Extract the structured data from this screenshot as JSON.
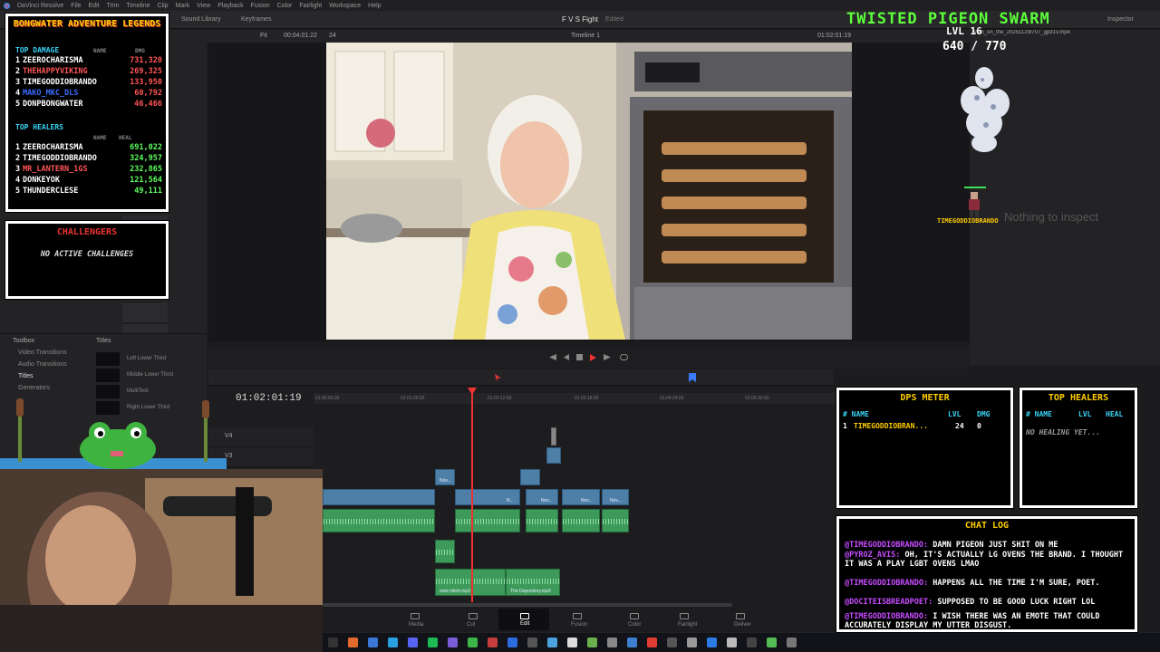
{
  "app": {
    "menu": [
      "DaVinci Resolve",
      "File",
      "Edit",
      "Trim",
      "Timeline",
      "Clip",
      "Mark",
      "View",
      "Playback",
      "Fusion",
      "Color",
      "Fairlight",
      "Workspace",
      "Help"
    ],
    "toolbar": {
      "sound_library": "Sound Library",
      "keyframes": "Keyframes",
      "inspector": "Inspector"
    },
    "project": {
      "name": "F V S Fight",
      "status": "Edited"
    }
  },
  "viewer": {
    "zoom": "Fit",
    "source_tc": "00:04:01:22",
    "fps": "24",
    "timeline_name": "Timeline 1",
    "record_tc": "01:02:01:19",
    "clip_name": "Man_on_the_20251129l707_gpd1v.mp4"
  },
  "inspector": {
    "empty_text": "Nothing to inspect"
  },
  "effects": {
    "toolbox_label": "Toolbox",
    "titles_header": "Titles",
    "items": [
      "Video Transitions",
      "Audio Transitions",
      "Titles",
      "Generators"
    ],
    "titles": [
      "Left Lower Third",
      "Middle Lower Third",
      "MultiText",
      "Right Lower Third"
    ]
  },
  "timeline": {
    "timecode": "01:02:01:19",
    "ruler": [
      "01:00:00:00",
      "01:01:36:00",
      "01:02:12:00",
      "01:03:18:00",
      "01:04:24:00",
      "01:05:30:00"
    ],
    "tracks": [
      "V4",
      "V3"
    ],
    "clip_labels": {
      "nov": "Nov...",
      "audio1": "oven bitch.mp3",
      "audio2": "The Depository.mp3",
      "n": "N..."
    }
  },
  "pages": [
    "Media",
    "Cut",
    "Edit",
    "Fusion",
    "Color",
    "Fairlight",
    "Deliver"
  ],
  "overlay": {
    "legends_title": "BONGWATER ADVENTURE LEGENDS",
    "top_damage_label": "TOP DAMAGE",
    "top_healers_label": "TOP HEALERS",
    "name_hdr": "NAME",
    "dmg_hdr": "DMG",
    "heal_hdr": "HEAL",
    "top_damage": [
      {
        "rank": "1",
        "name": "ZEEROCHARISMA",
        "value": "731,320",
        "color": "#ffffff",
        "vcolor": "#ff5555"
      },
      {
        "rank": "2",
        "name": "THEHAPPYVIKING",
        "value": "269,325",
        "color": "#ff5555",
        "vcolor": "#ff5555"
      },
      {
        "rank": "3",
        "name": "TIMEGODDIOBRANDO",
        "value": "133,950",
        "color": "#ffffff",
        "vcolor": "#ff5555"
      },
      {
        "rank": "4",
        "name": "MAKO_MKC_DLS",
        "value": "60,792",
        "color": "#3a6cff",
        "vcolor": "#ff5555"
      },
      {
        "rank": "5",
        "name": "DONPBONGWATER",
        "value": "46,466",
        "color": "#ffffff",
        "vcolor": "#ff5555"
      }
    ],
    "top_healers": [
      {
        "rank": "1",
        "name": "ZEEROCHARISMA",
        "value": "691,022",
        "color": "#ffffff",
        "vcolor": "#5cff5c"
      },
      {
        "rank": "2",
        "name": "TIMEGODDIOBRANDO",
        "value": "324,957",
        "color": "#ffffff",
        "vcolor": "#5cff5c"
      },
      {
        "rank": "3",
        "name": "MR_LANTERN_1GS",
        "value": "232,865",
        "color": "#ff5555",
        "vcolor": "#5cff5c"
      },
      {
        "rank": "4",
        "name": "DONKEYOK",
        "value": "121,564",
        "color": "#ffffff",
        "vcolor": "#5cff5c"
      },
      {
        "rank": "5",
        "name": "THUNDERCLESE",
        "value": "49,111",
        "color": "#ffffff",
        "vcolor": "#5cff5c"
      }
    ],
    "challengers_title": "CHALLENGERS",
    "challengers_msg": "NO ACTIVE CHALLENGES",
    "swarm_title": "TWISTED PIGEON SWARM",
    "boss_level": "LVL 16",
    "boss_hp": "640 / 770",
    "minion_name": "TIMEGODDIOBRANDO",
    "dps": {
      "title": "DPS METER",
      "name_hdr": "# NAME",
      "lvl_hdr": "LVL",
      "dmg_hdr": "DMG",
      "row": {
        "rank": "1",
        "name": "TIMEGODDIOBRAN...",
        "lvl": "24",
        "dmg": "0"
      }
    },
    "healers": {
      "title": "TOP HEALERS",
      "name_hdr": "# NAME",
      "lvl_hdr": "LVL",
      "heal_hdr": "HEAL",
      "empty": "NO HEALING YET..."
    },
    "chat": {
      "title": "CHAT LOG",
      "lines": [
        {
          "user": "@TIMEGODDIOBRANDO:",
          "text": "DAMN PIGEON JUST SHIT ON ME"
        },
        {
          "user": "@PYROZ_AVIS:",
          "text": "OH, IT'S ACTUALLY LG OVENS THE BRAND. I THOUGHT IT WAS A PLAY LGBT OVENS LMAO"
        },
        {
          "user": "@TIMEGODDIOBRANDO:",
          "text": "HAPPENS ALL THE TIME I'M SURE, POET."
        },
        {
          "user": "@DOCITEISBREADPOET:",
          "text": "SUPPOSED TO BE GOOD LUCK RIGHT LOL"
        },
        {
          "user": "@TIMEGODDIOBRANDO:",
          "text": "I WISH THERE WAS AN EMOTE THAT COULD ACCURATELY DISPLAY MY UTTER DISGUST."
        }
      ]
    }
  },
  "colors": {
    "accent": "#e33",
    "overlay_yellow": "#ffcc00",
    "overlay_cyan": "#3ad3f5",
    "swarm_green": "#5cff3a"
  }
}
